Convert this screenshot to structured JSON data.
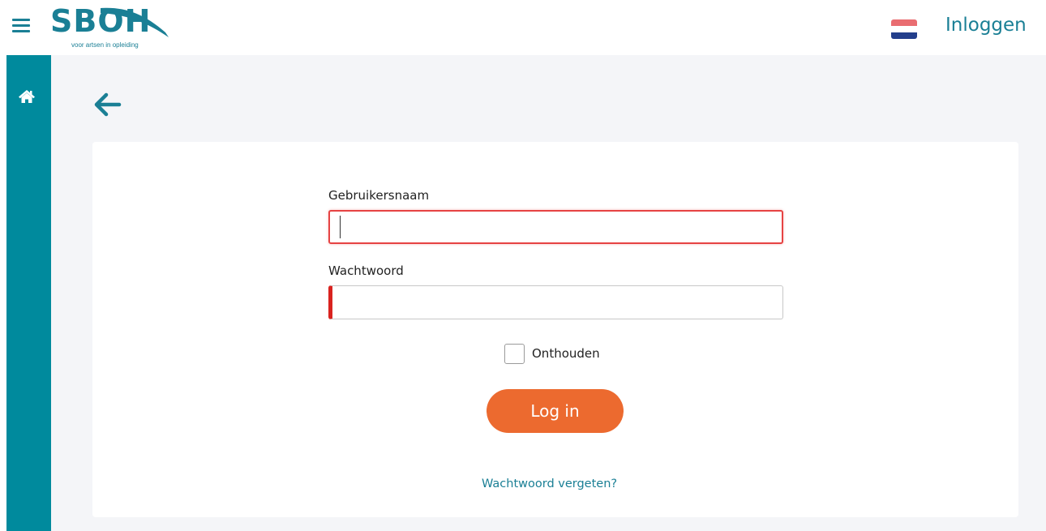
{
  "header": {
    "logo_text": "SBOH",
    "logo_tagline": "voor artsen in opleiding",
    "language_flag": "nl-flag-icon",
    "login_link": "Inloggen",
    "colors": {
      "brand": "#1a7f95",
      "sidebar": "#008a9d",
      "accent": "#ec6a2f",
      "error": "#d9231f"
    }
  },
  "sidebar": {
    "items": [
      {
        "icon": "home-icon"
      }
    ]
  },
  "form": {
    "username_label": "Gebruikersnaam",
    "username_value": "",
    "password_label": "Wachtwoord",
    "password_value": "",
    "remember_label": "Onthouden",
    "remember_checked": false,
    "submit_label": "Log in",
    "forgot_link": "Wachtwoord vergeten?"
  }
}
